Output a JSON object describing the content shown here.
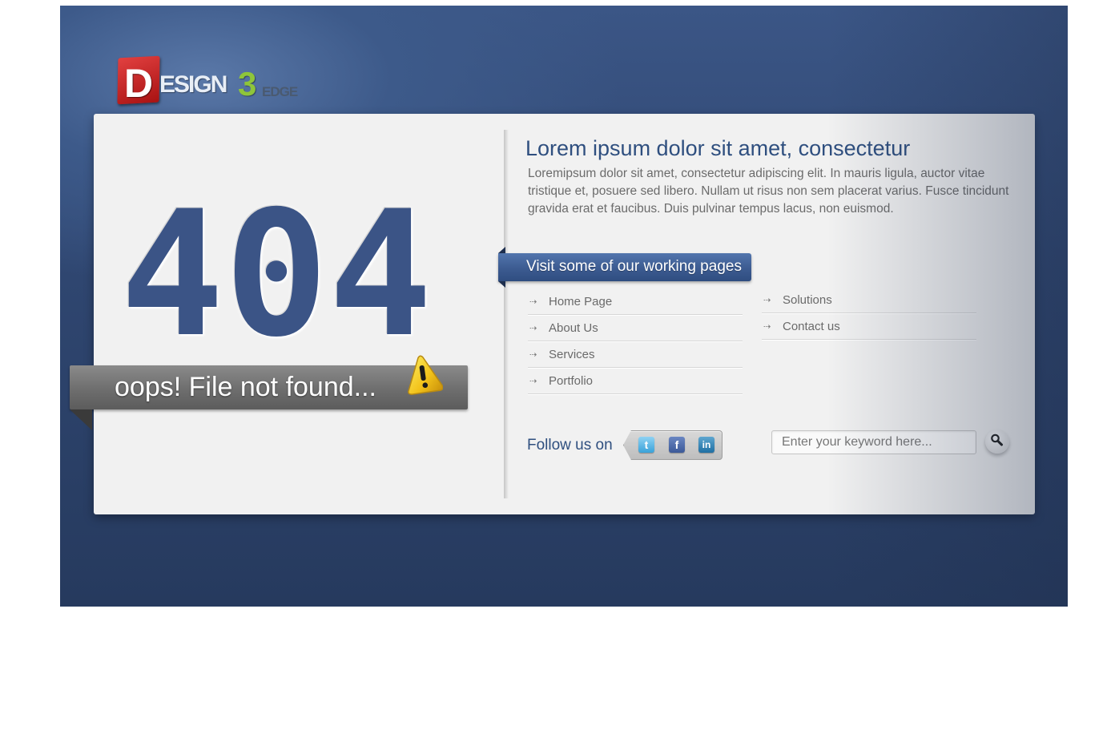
{
  "logo": {
    "letter": "D",
    "word": "ESIGN",
    "number": "3",
    "suffix": "EDGE"
  },
  "error": {
    "code_digits": [
      "4",
      "0",
      "4"
    ],
    "message": "oops! File not found...",
    "icon": "warning-icon"
  },
  "content": {
    "heading": "Lorem ipsum dolor sit amet, consectetur",
    "description": "Loremipsum dolor sit amet, consectetur adipiscing elit. In mauris ligula, auctor vitae tristique et, posuere sed libero. Nullam ut risus non sem placerat varius. Fusce tincidunt gravida erat et faucibus. Duis pulvinar tempus lacus, non euismod."
  },
  "links": {
    "ribbon_label": "Visit some of our working pages",
    "arrow": "⇢",
    "column_a": [
      {
        "label": "Home Page"
      },
      {
        "label": "About Us"
      },
      {
        "label": "Services"
      },
      {
        "label": "Portfolio"
      }
    ],
    "column_b": [
      {
        "label": "Solutions"
      },
      {
        "label": "Contact us"
      }
    ]
  },
  "social": {
    "label": "Follow us on",
    "networks": [
      {
        "name": "twitter",
        "glyph": "t",
        "icon": "twitter-icon"
      },
      {
        "name": "facebook",
        "glyph": "f",
        "icon": "facebook-icon"
      },
      {
        "name": "linkedin",
        "glyph": "in",
        "icon": "linkedin-icon"
      }
    ]
  },
  "search": {
    "placeholder": "Enter your keyword here...",
    "button_icon": "search-icon"
  },
  "colors": {
    "brand_blue": "#3b5486",
    "logo_red": "#c41e1e",
    "logo_green": "#8ec53a",
    "warning_yellow": "#f2c21a"
  }
}
